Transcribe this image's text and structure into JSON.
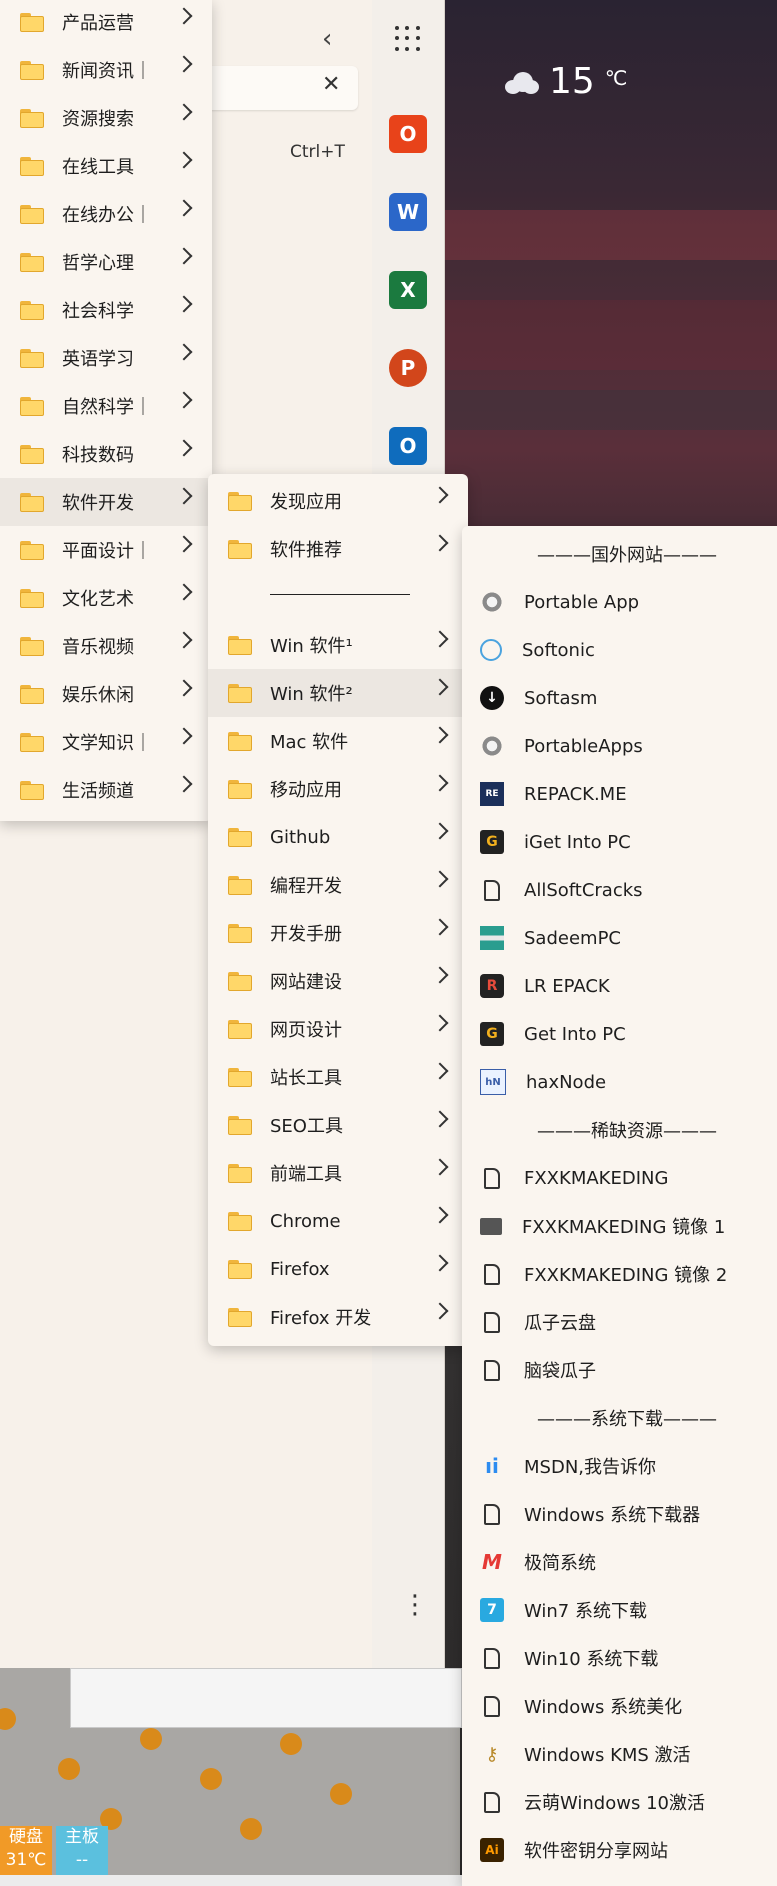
{
  "weather": {
    "temperature": "15",
    "unit": "℃",
    "icon": "cloud-icon"
  },
  "browser": {
    "shortcut": "Ctrl+T"
  },
  "sidebar_apps": [
    {
      "name": "office-icon",
      "color": "#e8431a"
    },
    {
      "name": "word-icon",
      "color": "#2b67c9"
    },
    {
      "name": "excel-icon",
      "color": "#1b7a3f"
    },
    {
      "name": "powerpoint-icon",
      "color": "#d2461b"
    },
    {
      "name": "outlook-icon",
      "color": "#0f6cbd"
    }
  ],
  "hardware": {
    "disk_label": "硬盘",
    "disk_value": "31℃",
    "board_label": "主板",
    "board_value": "--"
  },
  "menu1": {
    "items": [
      "产品运营",
      "新闻资讯｜",
      "资源搜索",
      "在线工具",
      "在线办公｜",
      "哲学心理",
      "社会科学",
      "英语学习",
      "自然科学｜",
      "科技数码",
      "软件开发",
      "平面设计｜",
      "文化艺术",
      "音乐视频",
      "娱乐休闲",
      "文学知识｜",
      "生活频道"
    ],
    "selected": "软件开发"
  },
  "menu2": {
    "top_items": [
      "发现应用",
      "软件推荐"
    ],
    "bottom_items": [
      "Win 软件¹",
      "Win 软件²",
      "Mac 软件",
      "移动应用",
      "Github",
      "编程开发",
      "开发手册",
      "网站建设",
      "网页设计",
      "站长工具",
      "SEO工具",
      "前端工具",
      "Chrome",
      "Firefox",
      "Firefox 开发"
    ],
    "selected": "Win 软件²"
  },
  "menu3": {
    "section1": "———国外网站———",
    "group1": [
      {
        "label": "Portable App",
        "icon": "portable-app-icon"
      },
      {
        "label": "Softonic",
        "icon": "softonic-icon"
      },
      {
        "label": "Softasm",
        "icon": "softasm-icon"
      },
      {
        "label": "PortableApps",
        "icon": "portableapps-icon"
      },
      {
        "label": "REPACK.ME",
        "icon": "repack-icon"
      },
      {
        "label": "iGet Into PC",
        "icon": "iget-icon"
      },
      {
        "label": "AllSoftCracks",
        "icon": "page-icon"
      },
      {
        "label": "SadeemPC",
        "icon": "sadeem-icon"
      },
      {
        "label": "LR EPACK",
        "icon": "lrepack-icon"
      },
      {
        "label": "Get Into PC",
        "icon": "getinto-icon"
      },
      {
        "label": "haxNode",
        "icon": "haxnode-icon"
      }
    ],
    "section2": "———稀缺资源———",
    "group2": [
      {
        "label": "FXXKMAKEDING",
        "icon": "page-icon"
      },
      {
        "label": "FXXKMAKEDING 镜像 1",
        "icon": "folder-icon"
      },
      {
        "label": "FXXKMAKEDING 镜像 2",
        "icon": "page-icon"
      },
      {
        "label": "瓜子云盘",
        "icon": "page-icon"
      },
      {
        "label": "脑袋瓜子",
        "icon": "page-icon"
      }
    ],
    "section3": "———系统下载———",
    "group3": [
      {
        "label": "MSDN,我告诉你",
        "icon": "msdn-icon"
      },
      {
        "label": "Windows 系统下载器",
        "icon": "page-icon"
      },
      {
        "label": "极简系统",
        "icon": "jijian-icon"
      },
      {
        "label": "Win7 系统下载",
        "icon": "win7-icon"
      },
      {
        "label": "Win10 系统下载",
        "icon": "page-icon"
      },
      {
        "label": "Windows 系统美化",
        "icon": "page-icon"
      },
      {
        "label": "Windows KMS 激活",
        "icon": "key-icon"
      },
      {
        "label": "云萌Windows 10激活",
        "icon": "page-icon"
      },
      {
        "label": "软件密钥分享网站",
        "icon": "ai-icon"
      }
    ]
  }
}
